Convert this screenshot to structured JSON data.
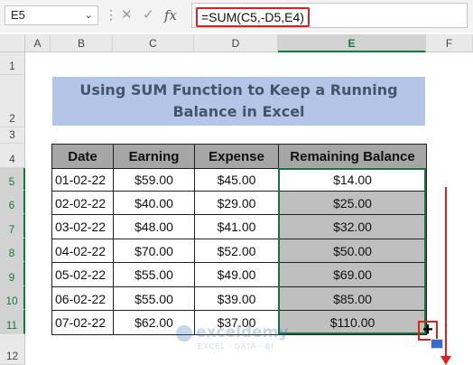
{
  "formula_bar": {
    "name_box": "E5",
    "cancel_icon": "✕",
    "enter_icon": "✓",
    "fx_label": "fx",
    "formula": "=SUM(C5,-D5,E4)"
  },
  "columns": [
    "A",
    "B",
    "C",
    "D",
    "E",
    "F"
  ],
  "rows": [
    "1",
    "2",
    "3",
    "4",
    "5",
    "6",
    "7",
    "8",
    "9",
    "10",
    "11",
    "12"
  ],
  "title": {
    "line1": "Using SUM Function to Keep a Running",
    "line2": "Balance in Excel"
  },
  "table": {
    "headers": [
      "Date",
      "Earning",
      "Expense",
      "Remaining Balance"
    ],
    "rows": [
      [
        "01-02-22",
        "$59.00",
        "$45.00",
        "$14.00"
      ],
      [
        "02-02-22",
        "$40.00",
        "$29.00",
        "$25.00"
      ],
      [
        "03-02-22",
        "$48.00",
        "$41.00",
        "$32.00"
      ],
      [
        "04-02-22",
        "$70.00",
        "$52.00",
        "$50.00"
      ],
      [
        "05-02-22",
        "$55.00",
        "$49.00",
        "$69.00"
      ],
      [
        "06-02-22",
        "$55.00",
        "$39.00",
        "$85.00"
      ],
      [
        "07-02-22",
        "$62.00",
        "$37.00",
        "$110.00"
      ]
    ]
  },
  "watermark": {
    "name": "exceldemy",
    "tagline": "EXCEL · DATA · BI"
  },
  "colors": {
    "title_bg": "#b4c6e7",
    "title_text": "#44546a",
    "header_bg": "#a6a6a6",
    "shade_bg": "#bfbfbf",
    "selection": "#1e7145",
    "highlight": "#e0201c"
  }
}
